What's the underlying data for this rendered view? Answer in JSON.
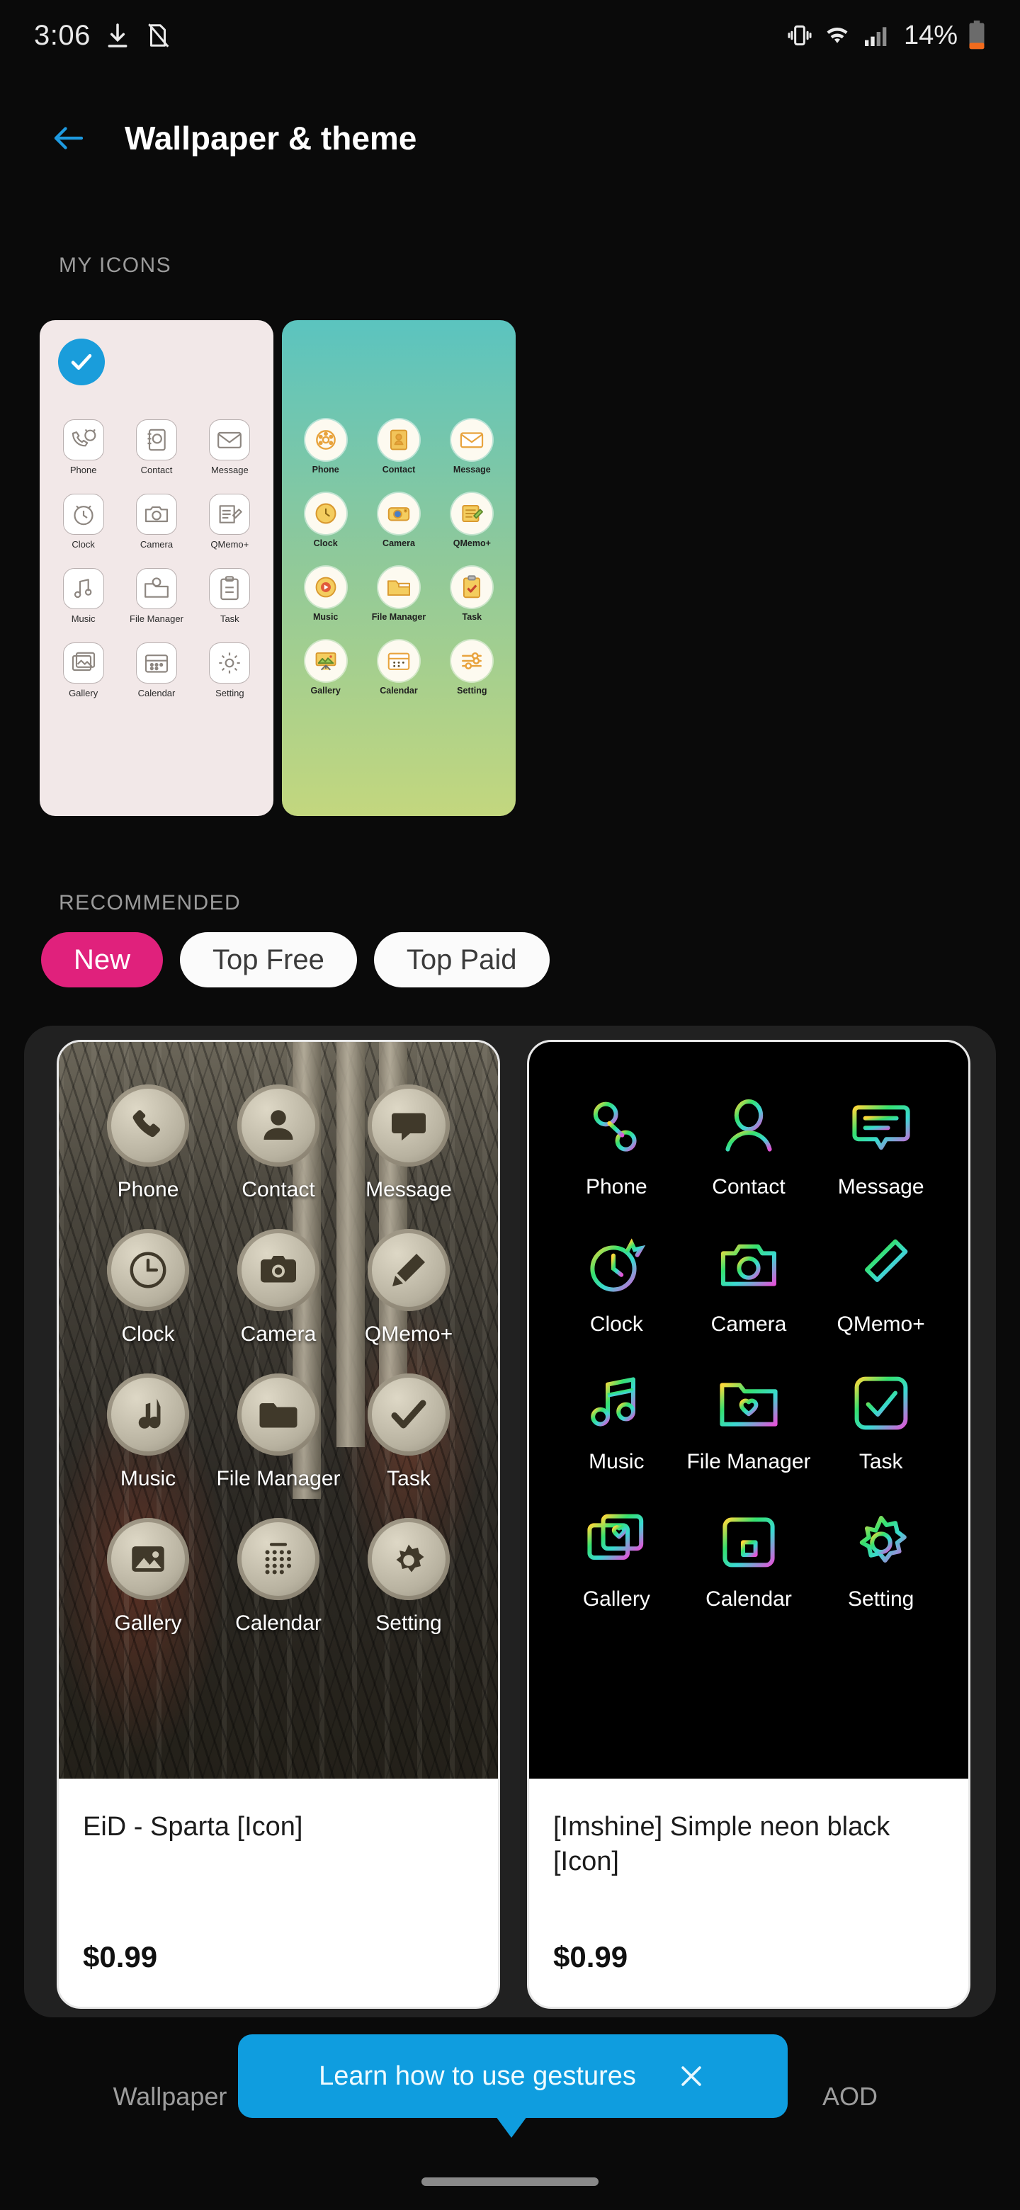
{
  "status_bar": {
    "time": "3:06",
    "battery_percent": "14%",
    "icons": [
      "download-icon",
      "sd-card-off-icon",
      "vibrate-icon",
      "wifi-icon",
      "signal-icon",
      "battery-low-icon"
    ]
  },
  "header": {
    "title": "Wallpaper & theme",
    "back_icon": "back-arrow-icon",
    "back_color": "#1e9ae0"
  },
  "my_icons": {
    "label": "MY ICONS",
    "themes": [
      {
        "name": "cat-pastel-theme",
        "selected": true,
        "background": "#f2e8e8",
        "apps": [
          "Phone",
          "Contact",
          "Message",
          "Clock",
          "Camera",
          "QMemo+",
          "Music",
          "File Manager",
          "Task",
          "Gallery",
          "Calendar",
          "Setting"
        ]
      },
      {
        "name": "yellow-gradient-theme",
        "selected": false,
        "background": "#5bc4bf",
        "apps": [
          "Phone",
          "Contact",
          "Message",
          "Clock",
          "Camera",
          "QMemo+",
          "Music",
          "File Manager",
          "Task",
          "Gallery",
          "Calendar",
          "Setting"
        ]
      }
    ]
  },
  "recommended": {
    "label": "RECOMMENDED",
    "chips": [
      {
        "label": "New",
        "active": true,
        "color": "#e0217c"
      },
      {
        "label": "Top Free",
        "active": false,
        "color": "#fbfbfb"
      },
      {
        "label": "Top Paid",
        "active": false,
        "color": "#fbfbfb"
      }
    ],
    "products": [
      {
        "title": "EiD - Sparta [Icon]",
        "price": "$0.99",
        "style": "forest",
        "apps": [
          "Phone",
          "Contact",
          "Message",
          "Clock",
          "Camera",
          "QMemo+",
          "Music",
          "File Manager",
          "Task",
          "Gallery",
          "Calendar",
          "Setting"
        ]
      },
      {
        "title": "[Imshine] Simple neon black [Icon]",
        "price": "$0.99",
        "style": "neon",
        "apps": [
          "Phone",
          "Contact",
          "Message",
          "Clock",
          "Camera",
          "QMemo+",
          "Music",
          "File Manager",
          "Task",
          "Gallery",
          "Calendar",
          "Setting"
        ]
      }
    ]
  },
  "bottom_tabs": [
    {
      "label": "Wallpaper"
    },
    {
      "label": ""
    },
    {
      "label": "AOD"
    }
  ],
  "tooltip": {
    "text": "Learn how to use gestures",
    "close_icon": "close-icon",
    "color": "#0f9ddf"
  }
}
